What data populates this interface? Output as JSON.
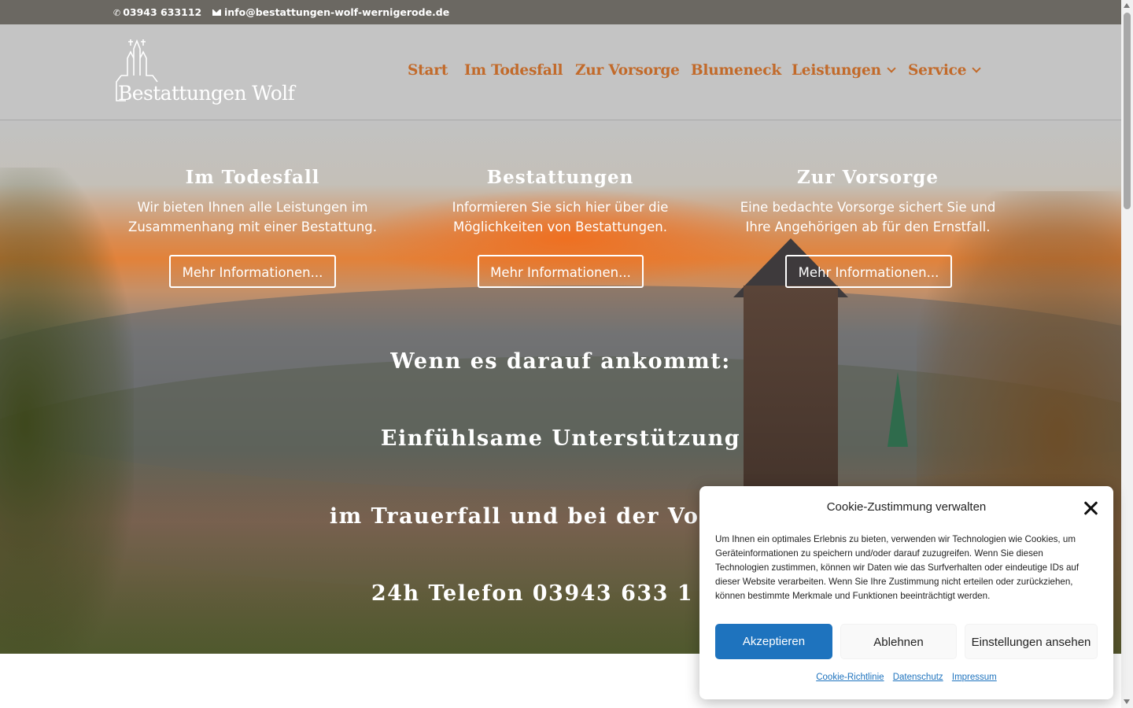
{
  "topbar": {
    "phone": "03943 633112",
    "email": "info@bestattungen-wolf-wernigerode.de"
  },
  "header": {
    "logo_text": "Bestattungen Wolf",
    "nav": [
      {
        "label": "Start"
      },
      {
        "label": "Im Todesfall"
      },
      {
        "label": "Zur Vorsorge"
      },
      {
        "label": "Blumeneck"
      },
      {
        "label": "Leistungen"
      },
      {
        "label": "Service"
      }
    ]
  },
  "hero": {
    "columns": [
      {
        "title": "Im Todesfall",
        "text": "Wir bieten Ihnen alle Leistungen im Zusammenhang mit einer Bestattung.",
        "button": "Mehr Informationen..."
      },
      {
        "title": "Bestattungen",
        "text": "Informieren Sie sich hier über die Möglichkeiten von Bestattungen.",
        "button": "Mehr Informationen..."
      },
      {
        "title": "Zur Vorsorge",
        "text": "Eine bedachte Vorsorge sichert Sie und Ihre Angehörigen ab für den Ernstfall.",
        "button": "Mehr Informationen..."
      }
    ],
    "slogan": [
      "Wenn es darauf ankommt:",
      "Einfühlsame Unterstützung",
      "im Trauerfall und bei der Vor",
      "24h Telefon 03943 633 1"
    ]
  },
  "cookie": {
    "title": "Cookie-Zustimmung verwalten",
    "message": "Um Ihnen ein optimales Erlebnis zu bieten, verwenden wir Technologien wie Cookies, um Geräteinformationen zu speichern und/oder darauf zuzugreifen. Wenn Sie diesen Technologien zustimmen, können wir Daten wie das Surfverhalten oder eindeutige IDs auf dieser Website verarbeiten. Wenn Sie Ihre Zustimmung nicht erteilen oder zurückziehen, können bestimmte Merkmale und Funktionen beeinträchtigt werden.",
    "accept": "Akzeptieren",
    "deny": "Ablehnen",
    "preferences": "Einstellungen ansehen",
    "links": [
      "Cookie-Richtlinie",
      "Datenschutz",
      "Impressum"
    ]
  },
  "colors": {
    "topbar": "#6b6862",
    "header": "#c4c4c4",
    "nav_accent": "#c26a2a",
    "accept_button": "#1e73be"
  },
  "icons": [
    "phone-icon",
    "envelope-icon",
    "close-icon",
    "chevron-down-icon"
  ]
}
